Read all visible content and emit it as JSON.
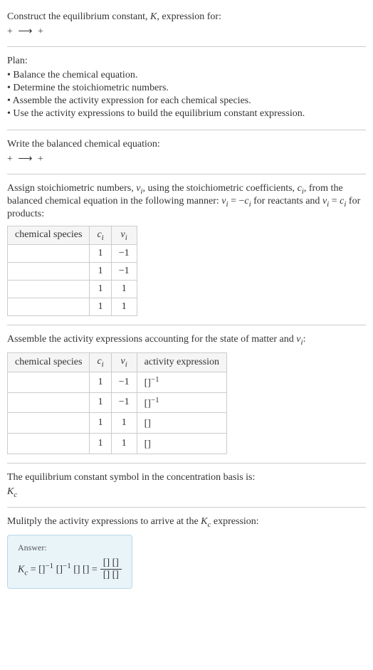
{
  "title": {
    "line1_prefix": "Construct the equilibrium constant, ",
    "K": "K",
    "line1_suffix": ", expression for:",
    "eq_left": " + ",
    "eq_arrow": "⟶",
    "eq_right": " + "
  },
  "plan": {
    "heading": "Plan:",
    "items": [
      "• Balance the chemical equation.",
      "• Determine the stoichiometric numbers.",
      "• Assemble the activity expression for each chemical species.",
      "• Use the activity expressions to build the equilibrium constant expression."
    ]
  },
  "balanced": {
    "heading": "Write the balanced chemical equation:",
    "eq_left": " + ",
    "eq_arrow": "⟶",
    "eq_right": " + "
  },
  "stoich": {
    "intro_1": "Assign stoichiometric numbers, ",
    "nu_i": "ν",
    "sub_i": "i",
    "intro_2": ", using the stoichiometric coefficients, ",
    "c_i": "c",
    "intro_3": ", from the balanced chemical equation in the following manner: ",
    "rel1_lhs": "ν",
    "rel1_eq": " = −",
    "rel1_rhs": "c",
    "intro_4": " for reactants and ",
    "rel2_lhs": "ν",
    "rel2_eq": " = ",
    "rel2_rhs": "c",
    "intro_5": " for products:",
    "headers": {
      "species": "chemical species",
      "ci": "c",
      "nui": "ν"
    },
    "rows": [
      {
        "species": "",
        "ci": "1",
        "nui": "−1"
      },
      {
        "species": "",
        "ci": "1",
        "nui": "−1"
      },
      {
        "species": "",
        "ci": "1",
        "nui": "1"
      },
      {
        "species": "",
        "ci": "1",
        "nui": "1"
      }
    ]
  },
  "activity": {
    "intro_1": "Assemble the activity expressions accounting for the state of matter and ",
    "nu_i": "ν",
    "sub_i": "i",
    "intro_2": ":",
    "headers": {
      "species": "chemical species",
      "ci": "c",
      "nui": "ν",
      "expr": "activity expression"
    },
    "rows": [
      {
        "species": "",
        "ci": "1",
        "nui": "−1",
        "expr_base": "[]",
        "expr_sup": "−1"
      },
      {
        "species": "",
        "ci": "1",
        "nui": "−1",
        "expr_base": "[]",
        "expr_sup": "−1"
      },
      {
        "species": "",
        "ci": "1",
        "nui": "1",
        "expr_base": "[]",
        "expr_sup": ""
      },
      {
        "species": "",
        "ci": "1",
        "nui": "1",
        "expr_base": "[]",
        "expr_sup": ""
      }
    ]
  },
  "symbol": {
    "intro": "The equilibrium constant symbol in the concentration basis is:",
    "K": "K",
    "sub": "c"
  },
  "multiply": {
    "intro_1": "Mulitply the activity expressions to arrive at the ",
    "K": "K",
    "sub": "c",
    "intro_2": " expression:"
  },
  "answer": {
    "label": "Answer:",
    "K": "K",
    "sub": "c",
    "eq": " = ",
    "term1_base": "[]",
    "term1_sup": "−1",
    "space": " ",
    "term2_base": "[]",
    "term2_sup": "−1",
    "term3": "[] []",
    "eq2": " = ",
    "frac_num": "[] []",
    "frac_den": "[] []"
  }
}
